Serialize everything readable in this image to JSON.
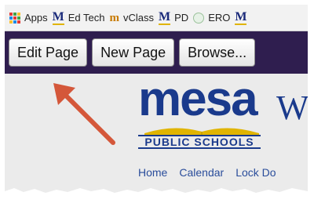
{
  "bookmarks": {
    "apps_label": "Apps",
    "items": [
      {
        "label": "Ed Tech",
        "icon": "mesa-m-icon"
      },
      {
        "label": "vClass",
        "icon": "vclass-icon"
      },
      {
        "label": "PD",
        "icon": "mesa-m-icon"
      },
      {
        "label": "ERO",
        "icon": "ero-icon"
      }
    ]
  },
  "toolbar": {
    "edit_label": "Edit Page",
    "new_label": "New Page",
    "browse_label": "Browse..."
  },
  "site": {
    "logo_word": "mesa",
    "logo_sub": "PUBLIC SCHOOLS",
    "heading_fragment": "W",
    "nav": [
      "Home",
      "Calendar",
      "Lock Do"
    ]
  },
  "colors": {
    "toolbar_bg": "#2f1e4f",
    "brand_blue": "#1a3a8c",
    "brand_gold": "#e0b400",
    "arrow": "#d4573a"
  }
}
